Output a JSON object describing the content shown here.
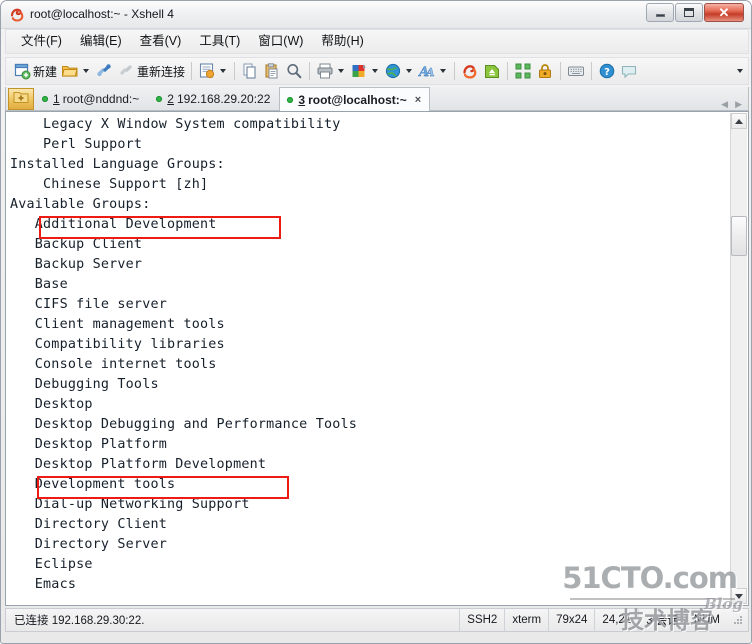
{
  "window": {
    "title": "root@localhost:~ - Xshell 4",
    "app_icon": "xshell-icon",
    "minimize_label": "",
    "maximize_label": "",
    "close_label": "✕"
  },
  "menu": {
    "items": [
      {
        "label": "文件(F)",
        "name": "menu-file"
      },
      {
        "label": "编辑(E)",
        "name": "menu-edit"
      },
      {
        "label": "查看(V)",
        "name": "menu-view"
      },
      {
        "label": "工具(T)",
        "name": "menu-tools"
      },
      {
        "label": "窗口(W)",
        "name": "menu-window"
      },
      {
        "label": "帮助(H)",
        "name": "menu-help"
      }
    ]
  },
  "toolbar": {
    "new_label": "新建",
    "reconnect_label": "重新连接",
    "icons": [
      "new-session-icon",
      "open-folder-icon",
      "connect-icon",
      "reconnect-icon",
      "properties-icon",
      "copy-icon",
      "paste-icon",
      "find-icon",
      "print-icon",
      "color-scheme-icon",
      "globe-icon",
      "font-icon",
      "xshell-icon",
      "xftp-icon",
      "fullscreen-icon",
      "lock-icon",
      "keyboard-icon",
      "help-icon",
      "chat-icon",
      "overflow-chevron-icon"
    ]
  },
  "tabs": {
    "home_button": "session-manager-icon",
    "items": [
      {
        "num": "1",
        "label": "root@nddnd:~",
        "active": false
      },
      {
        "num": "2",
        "label": "192.168.29.20:22",
        "active": false
      },
      {
        "num": "3",
        "label": "root@localhost:~",
        "active": true
      }
    ],
    "close_glyph": "×",
    "prev_glyph": "◀",
    "next_glyph": "▶"
  },
  "terminal": {
    "lines": [
      "    Legacy X Window System compatibility",
      "    Perl Support",
      "Installed Language Groups:",
      "    Chinese Support [zh]",
      "Available Groups:",
      "   Additional Development",
      "   Backup Client",
      "   Backup Server",
      "   Base",
      "   CIFS file server",
      "   Client management tools",
      "   Compatibility libraries",
      "   Console internet tools",
      "   Debugging Tools",
      "   Desktop",
      "   Desktop Debugging and Performance Tools",
      "   Desktop Platform",
      "   Desktop Platform Development",
      "   Development tools",
      "   Dial-up Networking Support",
      "   Directory Client",
      "   Directory Server",
      "   Eclipse",
      "   Emacs"
    ],
    "highlights": [
      {
        "label": "Additional Development",
        "line_index": 5
      },
      {
        "label": "Development tools",
        "line_index": 18
      }
    ]
  },
  "status": {
    "connection": "已连接 192.168.29.30:22.",
    "protocol": "SSH2",
    "term_type": "xterm",
    "size": "79x24",
    "cursor": "24,21",
    "sessions": "3 会话",
    "num_lock": "NUM"
  },
  "watermark": {
    "main": "51CTO.com",
    "sub": "技术博客",
    "blog": "Blog"
  }
}
